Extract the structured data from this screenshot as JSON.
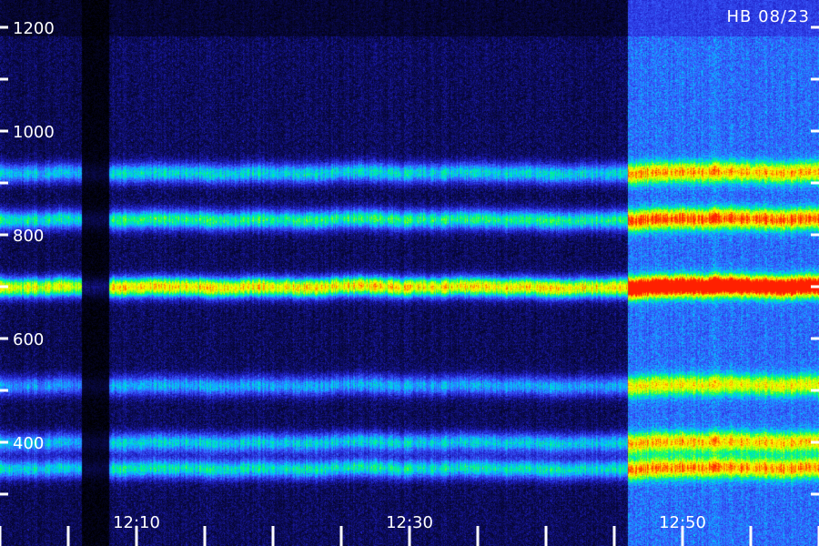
{
  "chart_data": {
    "type": "heatmap",
    "title": "",
    "xlabel": "",
    "ylabel": "",
    "stamp": "HB 08/23",
    "x_tick_labels": [
      "12:10",
      "12:30",
      "12:50"
    ],
    "y_tick_labels": [
      "1200",
      "1000",
      "800",
      "600",
      "400"
    ],
    "y_tick_values": [
      1200,
      1000,
      800,
      600,
      400
    ],
    "ylim": [
      260,
      1260
    ],
    "xlim": [
      "12:00",
      "12:60"
    ],
    "colormap": [
      "#000000",
      "#0a0a50",
      "#2020c8",
      "#3a5cff",
      "#00c8ff",
      "#00ff70",
      "#b0ff00",
      "#ffff00",
      "#ff8000",
      "#ff2000"
    ],
    "bands": [
      {
        "name": "band-low",
        "freq": 350,
        "intensity": 0.45
      },
      {
        "name": "band-lower-mid",
        "freq": 400,
        "intensity": 0.4
      },
      {
        "name": "band-mid",
        "freq": 510,
        "intensity": 0.35
      },
      {
        "name": "band-main",
        "freq": 700,
        "intensity": 0.78
      },
      {
        "name": "band-upper",
        "freq": 830,
        "intensity": 0.5
      },
      {
        "name": "band-high",
        "freq": 920,
        "intensity": 0.42
      }
    ],
    "segments": [
      {
        "start": "12:00",
        "end": "12:06",
        "level": 0.8
      },
      {
        "start": "12:06",
        "end": "12:08",
        "level": 0.15
      },
      {
        "start": "12:08",
        "end": "12:46",
        "level": 0.85
      },
      {
        "start": "12:46",
        "end": "12:60",
        "level": 1.6
      }
    ]
  }
}
